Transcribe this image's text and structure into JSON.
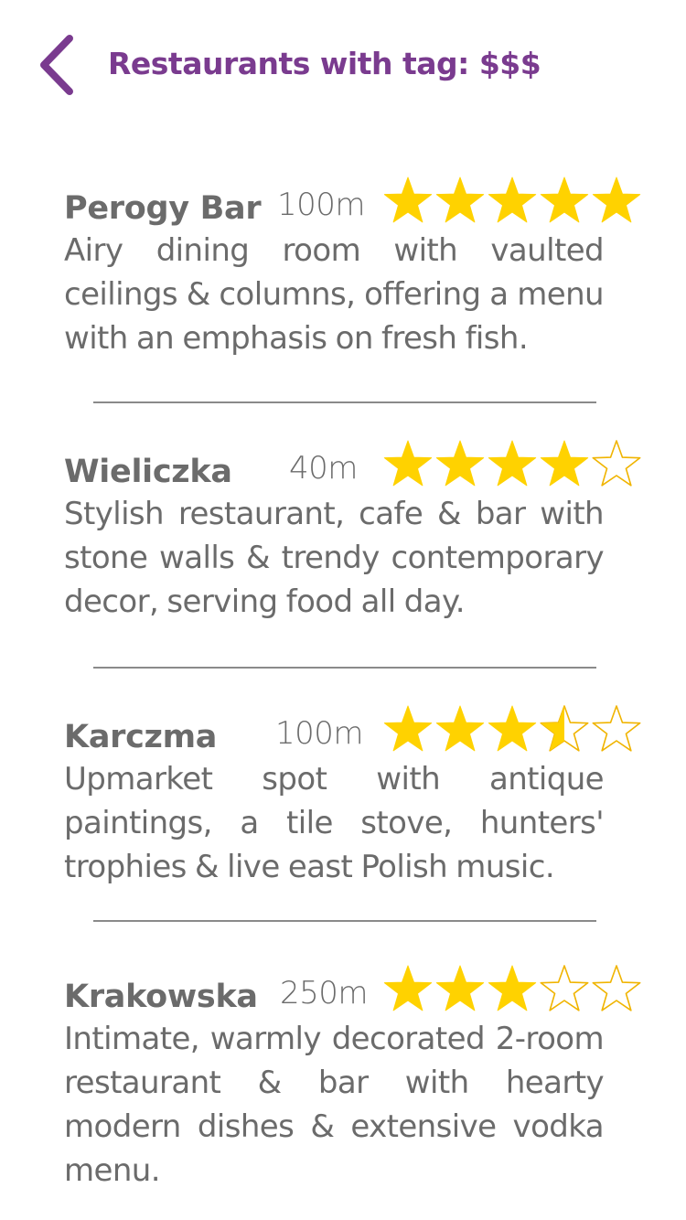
{
  "header": {
    "title": "Restaurants with tag: $$$",
    "back_icon": "chevron-left-icon"
  },
  "colors": {
    "accent": "#7a3b8f",
    "star_fill": "#ffd200",
    "star_stroke": "#f0b400",
    "text": "#6b6b6b",
    "divider": "#8a8a8a"
  },
  "restaurants": [
    {
      "name": "Perogy Bar",
      "distance": "100m",
      "rating": 5,
      "description": "Airy dining room with vaulted ceilings & columns, offering a menu with an emphasis on fresh fish."
    },
    {
      "name": "Wieliczka",
      "distance": "40m",
      "rating": 4,
      "description": "Stylish restaurant, cafe & bar with stone walls & trendy contemporary decor, serving food all day."
    },
    {
      "name": "Karczma",
      "distance": "100m",
      "rating": 3.5,
      "description": "Upmarket spot with antique paintings, a tile stove, hunters' trophies & live east Polish music."
    },
    {
      "name": "Krakowska",
      "distance": "250m",
      "rating": 3,
      "description": "Intimate, warmly decorated 2-room restaurant & bar with hearty modern dishes & extensive vodka menu."
    }
  ]
}
